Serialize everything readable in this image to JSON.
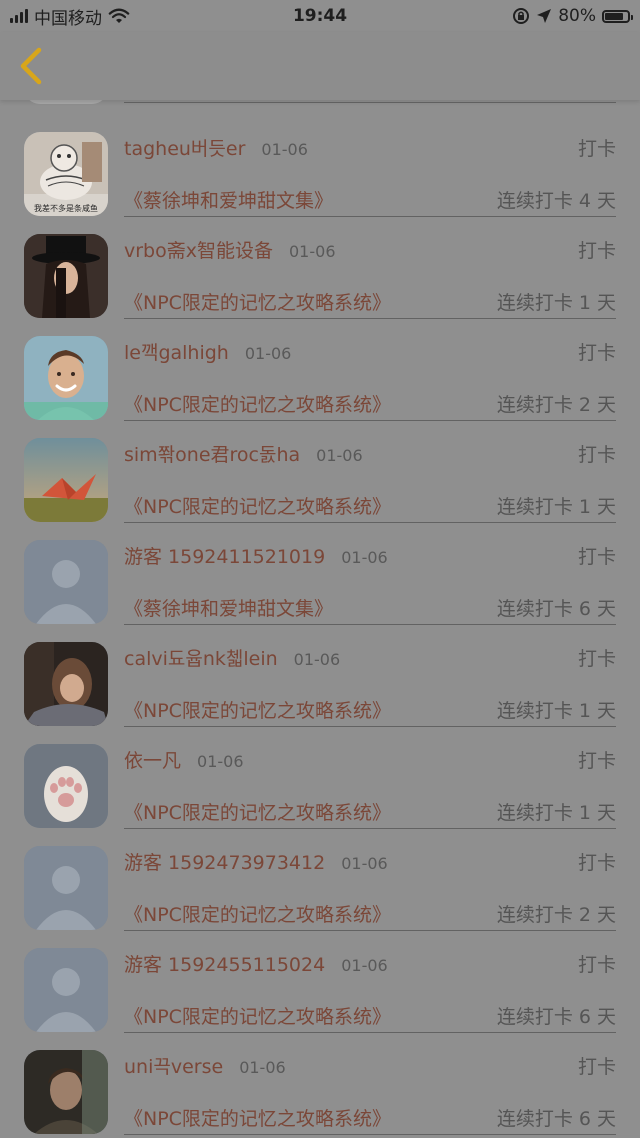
{
  "status_bar": {
    "carrier": "中国移动",
    "time": "19:44",
    "battery": "80%",
    "battery_level": 0.8
  },
  "nav": {
    "back_icon": "chevron-left-icon",
    "back_color": "#d8a61a"
  },
  "list": {
    "rows": [
      {
        "name": "tagheu버듯er",
        "date": "01-06",
        "action": "打卡",
        "book": "《蔡徐坤和爱坤甜文集》",
        "streak": "连续打卡 4 天",
        "avatar": "meme-avatar",
        "avatar_caption": "我差不多是条咸鱼"
      },
      {
        "name": "vrbo斋x智能设备",
        "date": "01-06",
        "action": "打卡",
        "book": "《NPC限定的记忆之攻略系统》",
        "streak": "连续打卡 1 天",
        "avatar": "top-hat-avatar"
      },
      {
        "name": "le깩galhigh",
        "date": "01-06",
        "action": "打卡",
        "book": "《NPC限定的记忆之攻略系统》",
        "streak": "连续打卡 2 天",
        "avatar": "smiling-man-avatar"
      },
      {
        "name": "sim쫚one君roc돐ha",
        "date": "01-06",
        "action": "打卡",
        "book": "《NPC限定的记忆之攻略系统》",
        "streak": "连续打卡 1 天",
        "avatar": "paper-crane-avatar"
      },
      {
        "name": "游客 1592411521019",
        "date": "01-06",
        "action": "打卡",
        "book": "《蔡徐坤和爱坤甜文集》",
        "streak": "连续打卡 6 天",
        "avatar": "default-user-avatar"
      },
      {
        "name": "calvi됴윱nk첿lein",
        "date": "01-06",
        "action": "打卡",
        "book": "《NPC限定的记忆之攻略系统》",
        "streak": "连续打卡 1 天",
        "avatar": "woman-avatar"
      },
      {
        "name": "依一凡",
        "date": "01-06",
        "action": "打卡",
        "book": "《NPC限定的记忆之攻略系统》",
        "streak": "连续打卡 1 天",
        "avatar": "cat-paw-avatar"
      },
      {
        "name": "游客 1592473973412",
        "date": "01-06",
        "action": "打卡",
        "book": "《NPC限定的记忆之攻略系统》",
        "streak": "连续打卡 2 天",
        "avatar": "default-user-avatar"
      },
      {
        "name": "游客 1592455115024",
        "date": "01-06",
        "action": "打卡",
        "book": "《NPC限定的记忆之攻略系统》",
        "streak": "连续打卡 6 天",
        "avatar": "default-user-avatar"
      },
      {
        "name": "uni끅verse",
        "date": "01-06",
        "action": "打卡",
        "book": "《NPC限定的记忆之攻略系统》",
        "streak": "连续打卡 6 天",
        "avatar": "man-portrait-avatar"
      }
    ]
  },
  "colors": {
    "name_color": "#7b4738",
    "book_color": "#7b4738",
    "muted_text": "#555555",
    "background": "#8f8f8f"
  }
}
